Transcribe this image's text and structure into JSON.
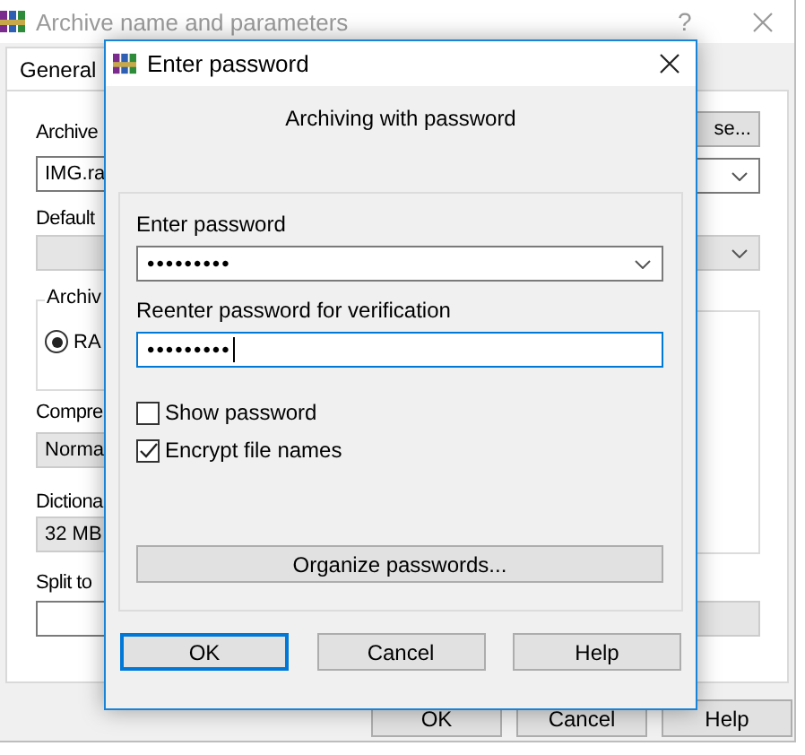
{
  "background_window": {
    "title": "Archive name and parameters",
    "help": "?",
    "tabs": [
      {
        "label": "General",
        "selected": true
      }
    ],
    "archive_label": "Archive",
    "archive_value": "IMG.ra",
    "browse_button": "se...",
    "default_label": "Default",
    "format_group_label": "Archiv",
    "format_radio": {
      "label": "RA",
      "selected": true
    },
    "compression_label": "Compre",
    "compression_value": "Norma",
    "dictionary_label": "Dictiona",
    "dictionary_value": "32 MB",
    "split_label": "Split to",
    "buttons": [
      "OK",
      "Cancel",
      "Help"
    ]
  },
  "dialog": {
    "title": "Enter password",
    "heading": "Archiving with password",
    "fields": [
      {
        "label": "Enter password",
        "value": "•••••••••",
        "kind": "combo",
        "focused": false
      },
      {
        "label": "Reenter password for verification",
        "value": "•••••••••",
        "kind": "text",
        "focused": true
      }
    ],
    "checkboxes": [
      {
        "label": "Show password",
        "checked": false
      },
      {
        "label": "Encrypt file names",
        "checked": true
      }
    ],
    "organize_button": "Organize passwords...",
    "buttons": [
      {
        "label": "OK",
        "default": true
      },
      {
        "label": "Cancel",
        "default": false
      },
      {
        "label": "Help",
        "default": false
      }
    ]
  }
}
